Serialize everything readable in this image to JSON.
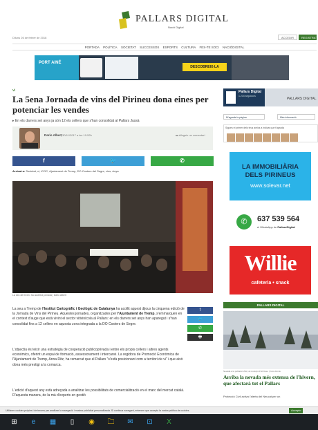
{
  "header": {
    "logo_text": "PALLARS DIGITAL",
    "logo_sub": "Nació Digital",
    "date": "Diluns 26 de febrer de 2018",
    "access_label": "ACCEDIR",
    "register_label": "REGISTRA'T"
  },
  "nav": [
    "PORTADA",
    "POLÍTICA",
    "SOCIETAT",
    "SUCCESSOS",
    "ESPORTS",
    "CULTURA",
    "FES-TE SOCI",
    "NACIÓDIGITAL"
  ],
  "banner": {
    "left_text": "PORT AINÉ",
    "cta": "DESCOBREIX-LA"
  },
  "article": {
    "section": "Vi",
    "title": "La 5ena Jornada de vins del Pirineu dona eines per potenciar les vendes",
    "lead": "En els darrers set anys ja són 12 els cellers que s'han consolidat al Pallars Jussà",
    "author": "Dario Albert",
    "pubdate": "| 30/11/2017 a les 10:52h",
    "comment": "Afegeix un comentari",
    "share": {
      "fb": "f",
      "tw": "🐦",
      "wa": "✆"
    },
    "tags_label": "Arxivat a:",
    "tags": "Societat, vi, ICGC, Ajuntament de Tremp, DO Costers del Segre, vins, vinya",
    "photo_caption": "La seu del ICGC ha acollit la jornada | Dario Albert",
    "p1_pre": "La seu a Tremp de ",
    "p1_bold1": "l'Institut Cartogràfic i Geològic de Catalunya",
    "p1_mid": " ha acollit aquest dijous la cinquena edició de la Jornada de Vins del Pirineu. Aquestes jornades, organitzades per ",
    "p1_bold2": "l'Ajuntament de Tremp",
    "p1_post": ", s'emmarquen en el context d'auge que està vivint el sector vitivinícola al Pallars: en els darrers set anys han aparegut i s'han consolidat fins a 12 cellers en aquesta zona integrada a la DO Costers de Segre.",
    "p2": "L'objectiu és teixir una estratègia de cooperació publicoprivada i entre els propis cellers i altres agents econòmics, oferint un espai de formació, assessorament i intercanvi. La regidora de Promoció Econòmica de l'Ajuntament de Tremp, Anna Ritz, ha remarcat que el Pallars \"s'està posicionant com a territori de vi\" i que això dona més prestigi a la comarca.",
    "p3": "L'edició d'aquest any està adreçada a analitzar les possibilitats de comercialització en el marc del mercat català. D'aquesta manera, de la mà d'experts en gestió",
    "mini_share": [
      "f",
      "🐦",
      "✆",
      "🖶"
    ]
  },
  "sidebar": {
    "fb_title": "Pallars Digital",
    "fb_sub": "1.234 seguidors",
    "fb_cover": "PALLARS DIGITAL",
    "fb_like": "M'agrada la pàgina",
    "fb_more": "Més informació",
    "fb_friends": "Sigues el primer dels teus amics a indicar que t'agrada",
    "ad1_l1": "LA IMMOBILIÀRIA",
    "ad1_l2": "DELS PIRINEUS",
    "ad1_l3": "www.solevar.net",
    "ad2_num": "637 539 564",
    "ad2_sub_pre": "el WhatsApp de ",
    "ad2_sub_bold": "PallarsDigital",
    "ad3_l1": "Willie",
    "ad3_l2": "cafeteria • snack",
    "section_head": "PALLARS DIGITAL",
    "snow_caption": "Nevada a la població d'Isil, al municipi d'Alt Àneu | Foto d'arxiu",
    "snow_title": "Arriba la nevada més extensa de l'hivern, que afectarà tot el Pallars",
    "snow_text": "Protecció Civil activa l'alerta del Neucat per un"
  },
  "cookie": {
    "text": "Utilitzem cookies pròpies i de tercers per analitzar la navegació i mostrar publicitat personalitzada. Si continua navegant, entenem que accepta la nostra política de cookies.",
    "ok": "Accepto"
  },
  "taskbar": [
    "⊞",
    "e",
    "▦",
    "▯",
    "◉",
    "🗀",
    "✉",
    "⊡",
    "X"
  ]
}
